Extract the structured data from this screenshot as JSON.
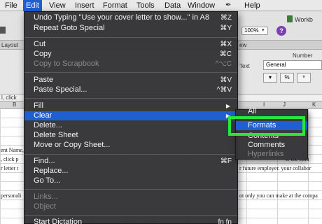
{
  "menubar": {
    "items": [
      "File",
      "Edit",
      "View",
      "Insert",
      "Format",
      "Tools",
      "Data",
      "Window",
      "Help"
    ],
    "active": "Edit"
  },
  "background": {
    "workbook_title": "Workb",
    "zoom_value": "100%",
    "help_icon_glyph": "?",
    "ribbon_tab_left": "Layout",
    "ribbon_tab_right": "ew",
    "number_label": "Number",
    "number_format": "General",
    "text_label": "Text",
    "percent_symbol": "%",
    "comma_symbol": "⁹",
    "col_b": "B",
    "col_i": "I",
    "col_j": "J",
    "col_k": "K",
    "row_cell_left": "l, click",
    "doc_lines": [
      "ent Name,",
      ", click p",
      "r letter t",
      "",
      "",
      "personali"
    ],
    "doc_lines_right": [
      "te the colu",
      "r future employer. your collabor",
      "ot only you can make at the compa"
    ]
  },
  "edit_menu": {
    "items": [
      {
        "label": "Undo Typing \"Use your cover letter to show...\" in A8",
        "shortcut": "⌘Z",
        "disabled": false
      },
      {
        "label": "Repeat Goto Special",
        "shortcut": "⌘Y",
        "disabled": false
      },
      {
        "label": "Cut",
        "shortcut": "⌘X",
        "disabled": false
      },
      {
        "label": "Copy",
        "shortcut": "⌘C",
        "disabled": false
      },
      {
        "label": "Copy to Scrapbook",
        "shortcut": "^⌥C",
        "disabled": true
      },
      {
        "label": "Paste",
        "shortcut": "⌘V",
        "disabled": false
      },
      {
        "label": "Paste Special...",
        "shortcut": "^⌘V",
        "disabled": false
      },
      {
        "label": "Fill",
        "shortcut": "",
        "disabled": false
      },
      {
        "label": "Clear",
        "shortcut": "",
        "disabled": false
      },
      {
        "label": "Delete...",
        "shortcut": "",
        "disabled": false
      },
      {
        "label": "Delete Sheet",
        "shortcut": "",
        "disabled": false
      },
      {
        "label": "Move or Copy Sheet...",
        "shortcut": "",
        "disabled": false
      },
      {
        "label": "Find...",
        "shortcut": "⌘F",
        "disabled": false
      },
      {
        "label": "Replace...",
        "shortcut": "",
        "disabled": false
      },
      {
        "label": "Go To...",
        "shortcut": "",
        "disabled": false
      },
      {
        "label": "Links...",
        "shortcut": "",
        "disabled": true
      },
      {
        "label": "Object",
        "shortcut": "",
        "disabled": true
      },
      {
        "label": "Start Dictation",
        "shortcut": "fn fn",
        "disabled": false
      }
    ],
    "submenu_arrow": "▶"
  },
  "clear_submenu": {
    "items": [
      {
        "label": "All",
        "disabled": false
      },
      {
        "label": "Formats",
        "disabled": false,
        "selected": true
      },
      {
        "label": "Contents",
        "disabled": false
      },
      {
        "label": "Comments",
        "disabled": false
      },
      {
        "label": "Hyperlinks",
        "disabled": true
      }
    ]
  },
  "colors": {
    "menu_bg": "#343436",
    "highlight": "#1f5fd2",
    "annotation_green": "#27e83a",
    "disabled_text": "#8a8a8a"
  }
}
